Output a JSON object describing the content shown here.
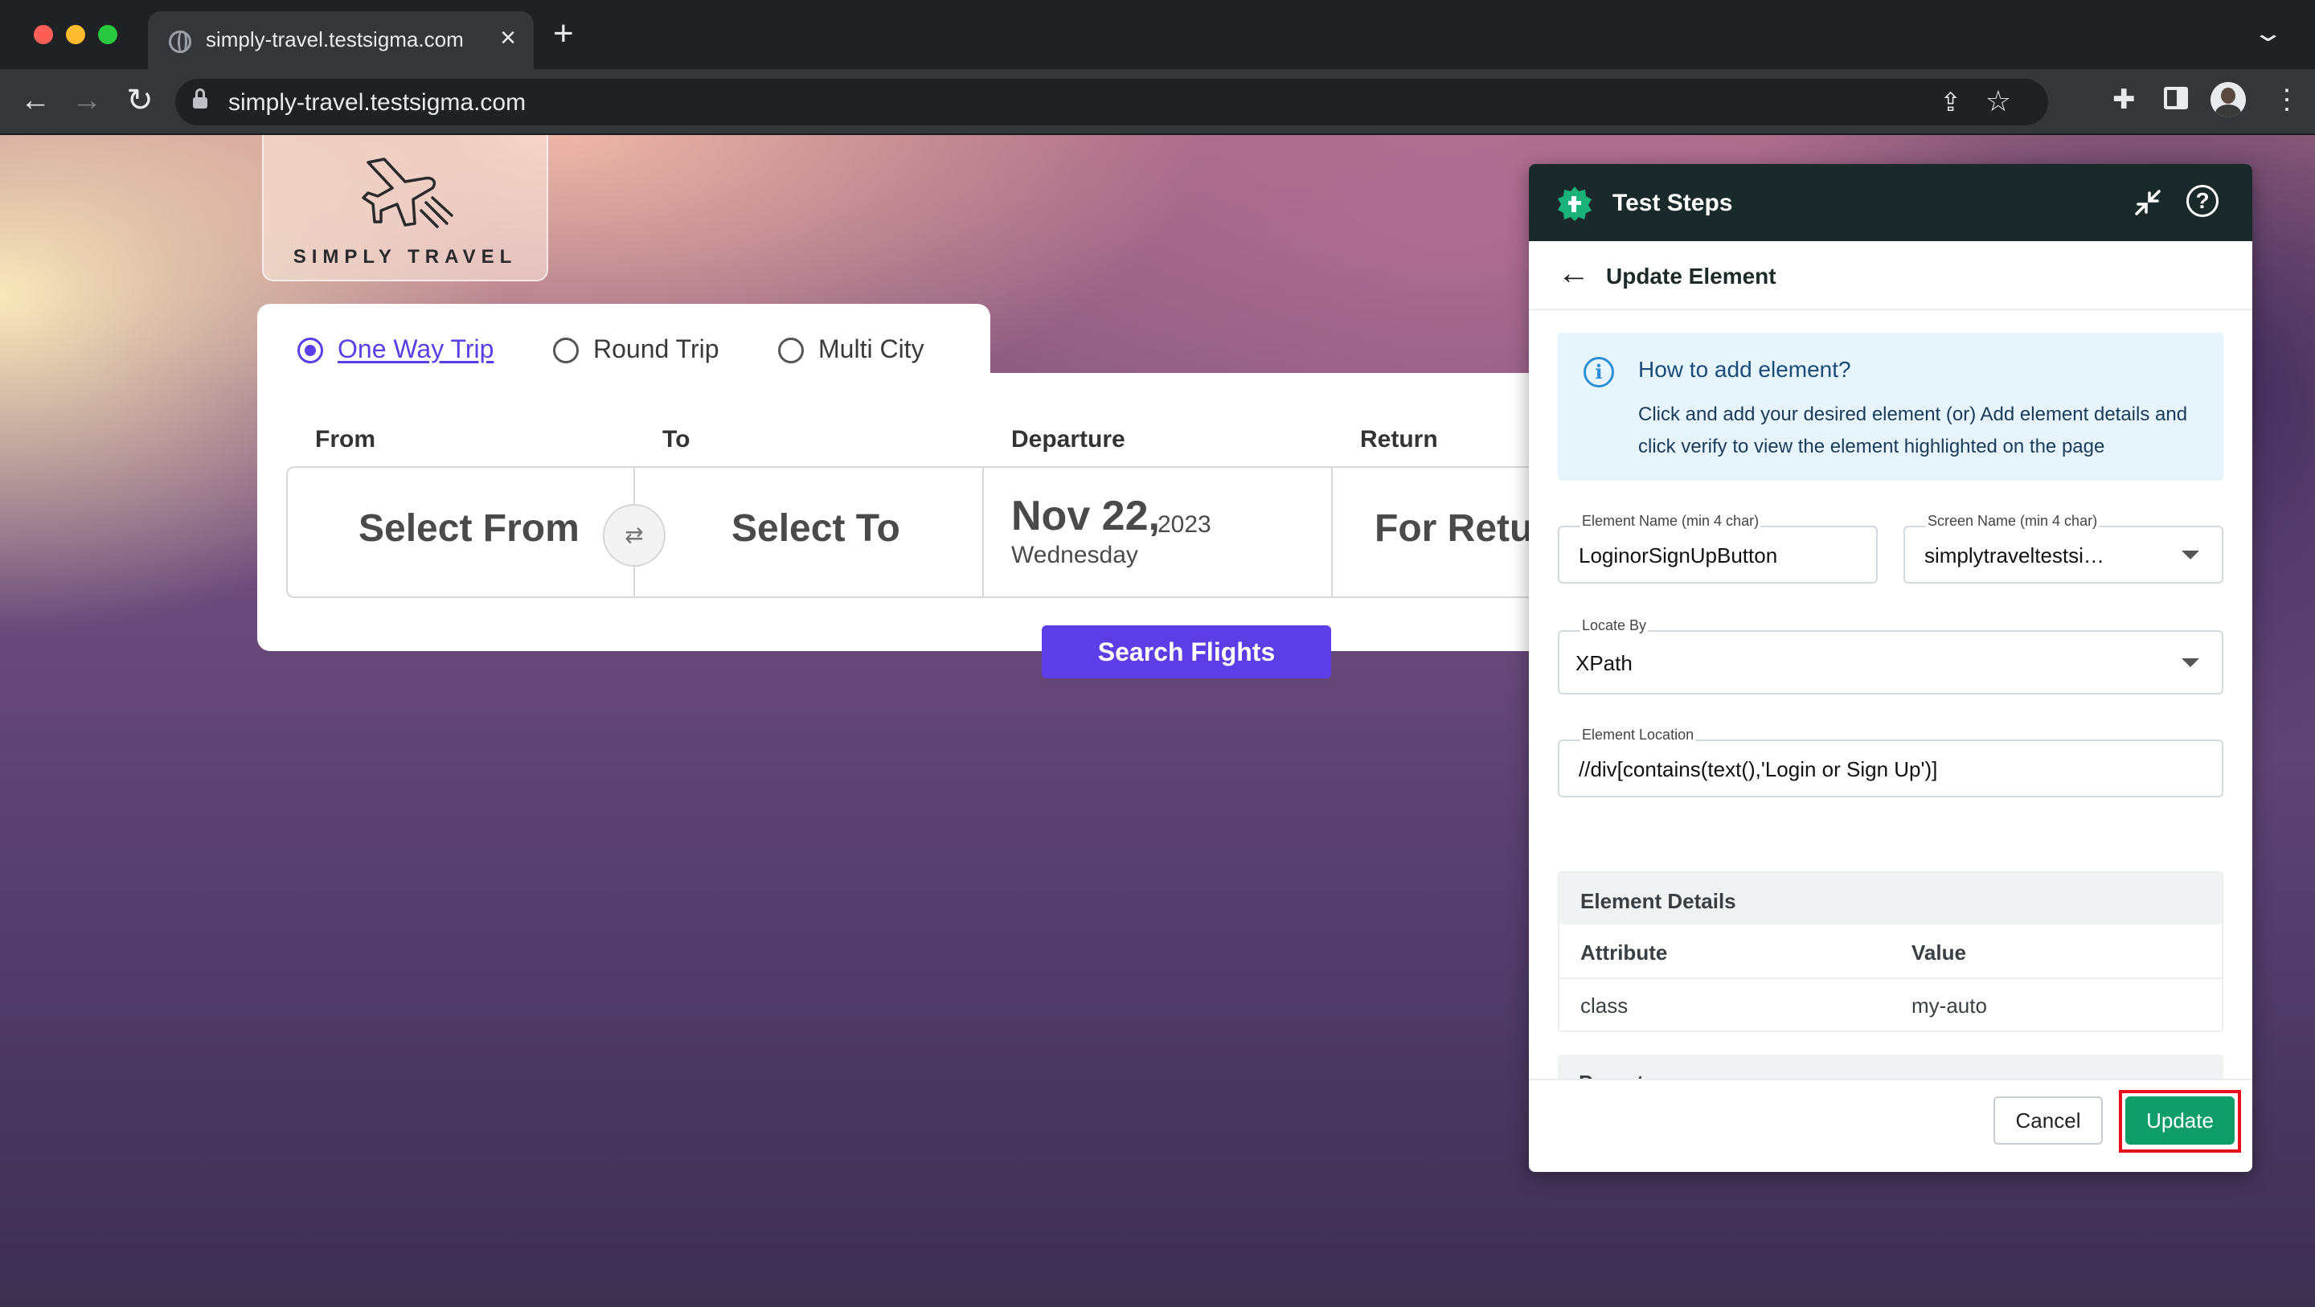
{
  "browser": {
    "tab_title": "simply-travel.testsigma.com",
    "url": "simply-travel.testsigma.com",
    "icons": [
      "globe-icon",
      "close-icon",
      "plus-icon",
      "chevron-down-icon",
      "back-arrow-icon",
      "forward-arrow-icon",
      "reload-icon",
      "lock-icon",
      "share-icon",
      "star-icon",
      "puzzle-icon",
      "side-panel-icon",
      "avatar",
      "kebab-menu-icon"
    ]
  },
  "site": {
    "logo_text": "SIMPLY TRAVEL",
    "trip_types": [
      {
        "label": "One Way Trip",
        "selected": true
      },
      {
        "label": "Round Trip",
        "selected": false
      },
      {
        "label": "Multi City",
        "selected": false
      }
    ],
    "fields": {
      "from_label": "From",
      "to_label": "To",
      "departure_label": "Departure",
      "return_label": "Return",
      "from_value": "Select From",
      "to_value": "Select To",
      "departure_date": "Nov 22,",
      "departure_year": "2023",
      "departure_day": "Wednesday",
      "return_value": "For Retur",
      "swap_icon": "⇄"
    },
    "search_button": "Search Flights",
    "accent_color": "#5c3ee6"
  },
  "panel": {
    "title": "Test Steps",
    "subtitle": "Update Element",
    "help_glyph": "?",
    "info": {
      "icon": "i",
      "title": "How to add element?",
      "body": "Click and add your desired element (or) Add element details and click verify to view the element highlighted on the page"
    },
    "element_name": {
      "label": "Element Name (min 4 char)",
      "value": "LoginorSignUpButton"
    },
    "screen_name": {
      "label": "Screen Name (min 4 char)",
      "value": "simplytraveltestsi…"
    },
    "locate_by": {
      "label": "Locate By",
      "value": "XPath"
    },
    "element_location": {
      "label": "Element Location",
      "value": "//div[contains(text(),'Login or Sign Up')]"
    },
    "details": {
      "title": "Element Details",
      "col_attribute": "Attribute",
      "col_value": "Value",
      "rows": [
        {
          "attribute": "class",
          "value": "my-auto"
        }
      ],
      "next_section": "Parent"
    },
    "cancel_label": "Cancel",
    "update_label": "Update",
    "brand_color": "#0f9e6a",
    "highlight_color": "#e8101a"
  }
}
